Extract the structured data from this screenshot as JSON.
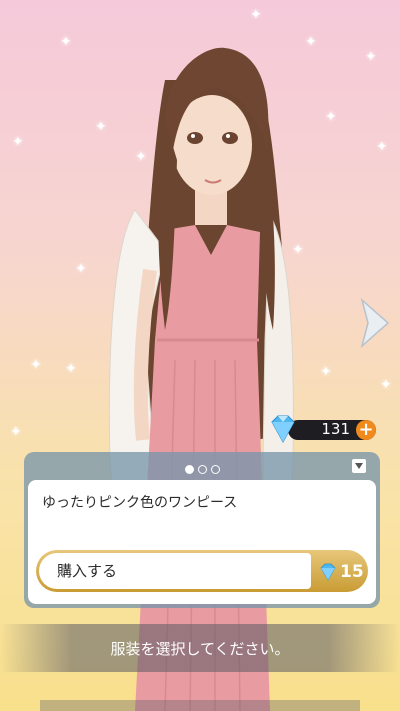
{
  "gems": {
    "count": "131",
    "add_symbol": "+"
  },
  "outfit": {
    "pager": {
      "total": 3,
      "active": 0
    },
    "description": "ゆったりピンク色のワンピース",
    "buy_label": "購入する",
    "price": "15"
  },
  "hint": "服装を選択してください。",
  "icons": {
    "next": "chevron-right-icon",
    "gem": "diamond-icon",
    "add": "plus-icon",
    "collapse": "triangle-down-icon"
  },
  "colors": {
    "bg_top": "#f5c9da",
    "bg_bottom": "#f8e08c",
    "buy_gold": "#c99c34",
    "gem_blue": "#4fb7f0",
    "add_orange": "#f08a1c"
  }
}
